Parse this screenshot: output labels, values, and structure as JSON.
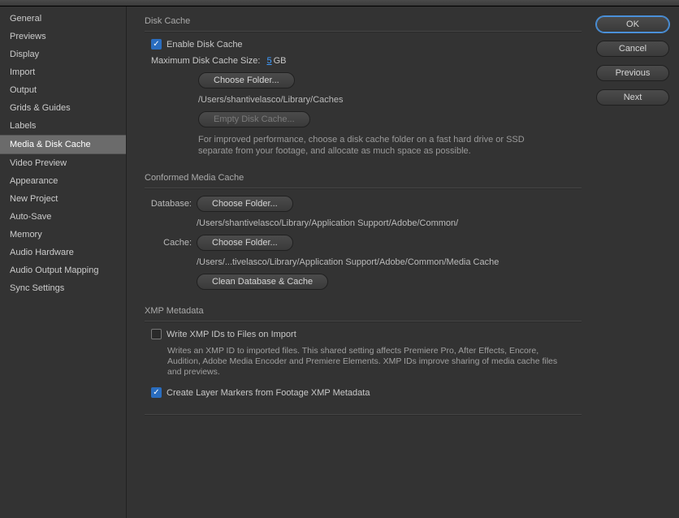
{
  "sidebar": {
    "items": [
      {
        "label": "General"
      },
      {
        "label": "Previews"
      },
      {
        "label": "Display"
      },
      {
        "label": "Import"
      },
      {
        "label": "Output"
      },
      {
        "label": "Grids & Guides"
      },
      {
        "label": "Labels"
      },
      {
        "label": "Media & Disk Cache"
      },
      {
        "label": "Video Preview"
      },
      {
        "label": "Appearance"
      },
      {
        "label": "New Project"
      },
      {
        "label": "Auto-Save"
      },
      {
        "label": "Memory"
      },
      {
        "label": "Audio Hardware"
      },
      {
        "label": "Audio Output Mapping"
      },
      {
        "label": "Sync Settings"
      }
    ],
    "activeIndex": 7
  },
  "buttons": {
    "ok": "OK",
    "cancel": "Cancel",
    "previous": "Previous",
    "next": "Next"
  },
  "diskCache": {
    "title": "Disk Cache",
    "enableLabel": "Enable Disk Cache",
    "enableChecked": true,
    "maxLabel": "Maximum Disk Cache Size:",
    "maxValue": "5",
    "maxUnit": "GB",
    "chooseFolder": "Choose Folder...",
    "path": "/Users/shantivelasco/Library/Caches",
    "emptyLabel": "Empty Disk Cache...",
    "help": "For improved performance, choose a disk cache folder on a fast hard drive or SSD separate from your footage, and allocate as much space as possible."
  },
  "conformed": {
    "title": "Conformed Media Cache",
    "dbLabel": "Database:",
    "dbChoose": "Choose Folder...",
    "dbPath": "/Users/shantivelasco/Library/Application Support/Adobe/Common/",
    "cacheLabel": "Cache:",
    "cacheChoose": "Choose Folder...",
    "cachePath": "/Users/...tivelasco/Library/Application Support/Adobe/Common/Media Cache",
    "clean": "Clean Database & Cache"
  },
  "xmp": {
    "title": "XMP Metadata",
    "writeLabel": "Write XMP IDs to Files on Import",
    "writeChecked": false,
    "writeHelp": "Writes an XMP ID to imported files. This shared setting affects Premiere Pro, After Effects, Encore, Audition, Adobe Media Encoder and Premiere Elements. XMP IDs improve sharing of media cache files and previews.",
    "markersLabel": "Create Layer Markers from Footage XMP Metadata",
    "markersChecked": true
  }
}
